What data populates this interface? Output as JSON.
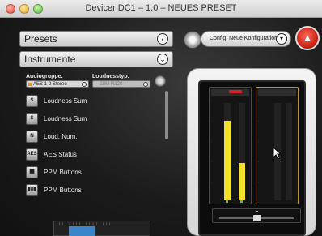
{
  "window": {
    "title": "Devicer DC1 – 1.0 – NEUES PRESET"
  },
  "left_panel": {
    "presets_label": "Presets",
    "instrumente_label": "Instrumente",
    "audiogruppe_label": "Audiogruppe:",
    "audiogruppe_value": "AES 1-2 Stereo",
    "loudnesstyp_label": "Loudnesstyp:",
    "loudnesstyp_value": "EBU R128",
    "list": [
      {
        "icon": "loudness-sum-icon",
        "label": "Loudness Sum"
      },
      {
        "icon": "loudness-sum-icon",
        "label": "Loudness Sum"
      },
      {
        "icon": "loud-num-icon",
        "label": "Loud. Num."
      },
      {
        "icon": "aes-status-icon",
        "label": "AES Status"
      },
      {
        "icon": "ppm-buttons-icon",
        "label": "PPM Buttons"
      },
      {
        "icon": "ppm-buttons-icon",
        "label": "PPM Buttons"
      }
    ]
  },
  "config": {
    "label": "Config: Neue Konfiguration"
  },
  "colors": {
    "accent_red": "#d8222a",
    "meter_yellow": "#f2e02a",
    "meter_green": "#4ec24e",
    "selection_gold": "#b8932c"
  },
  "meters": {
    "left_fill": [
      0.82,
      0.38
    ],
    "right_fill": [
      0.0,
      0.0
    ]
  }
}
